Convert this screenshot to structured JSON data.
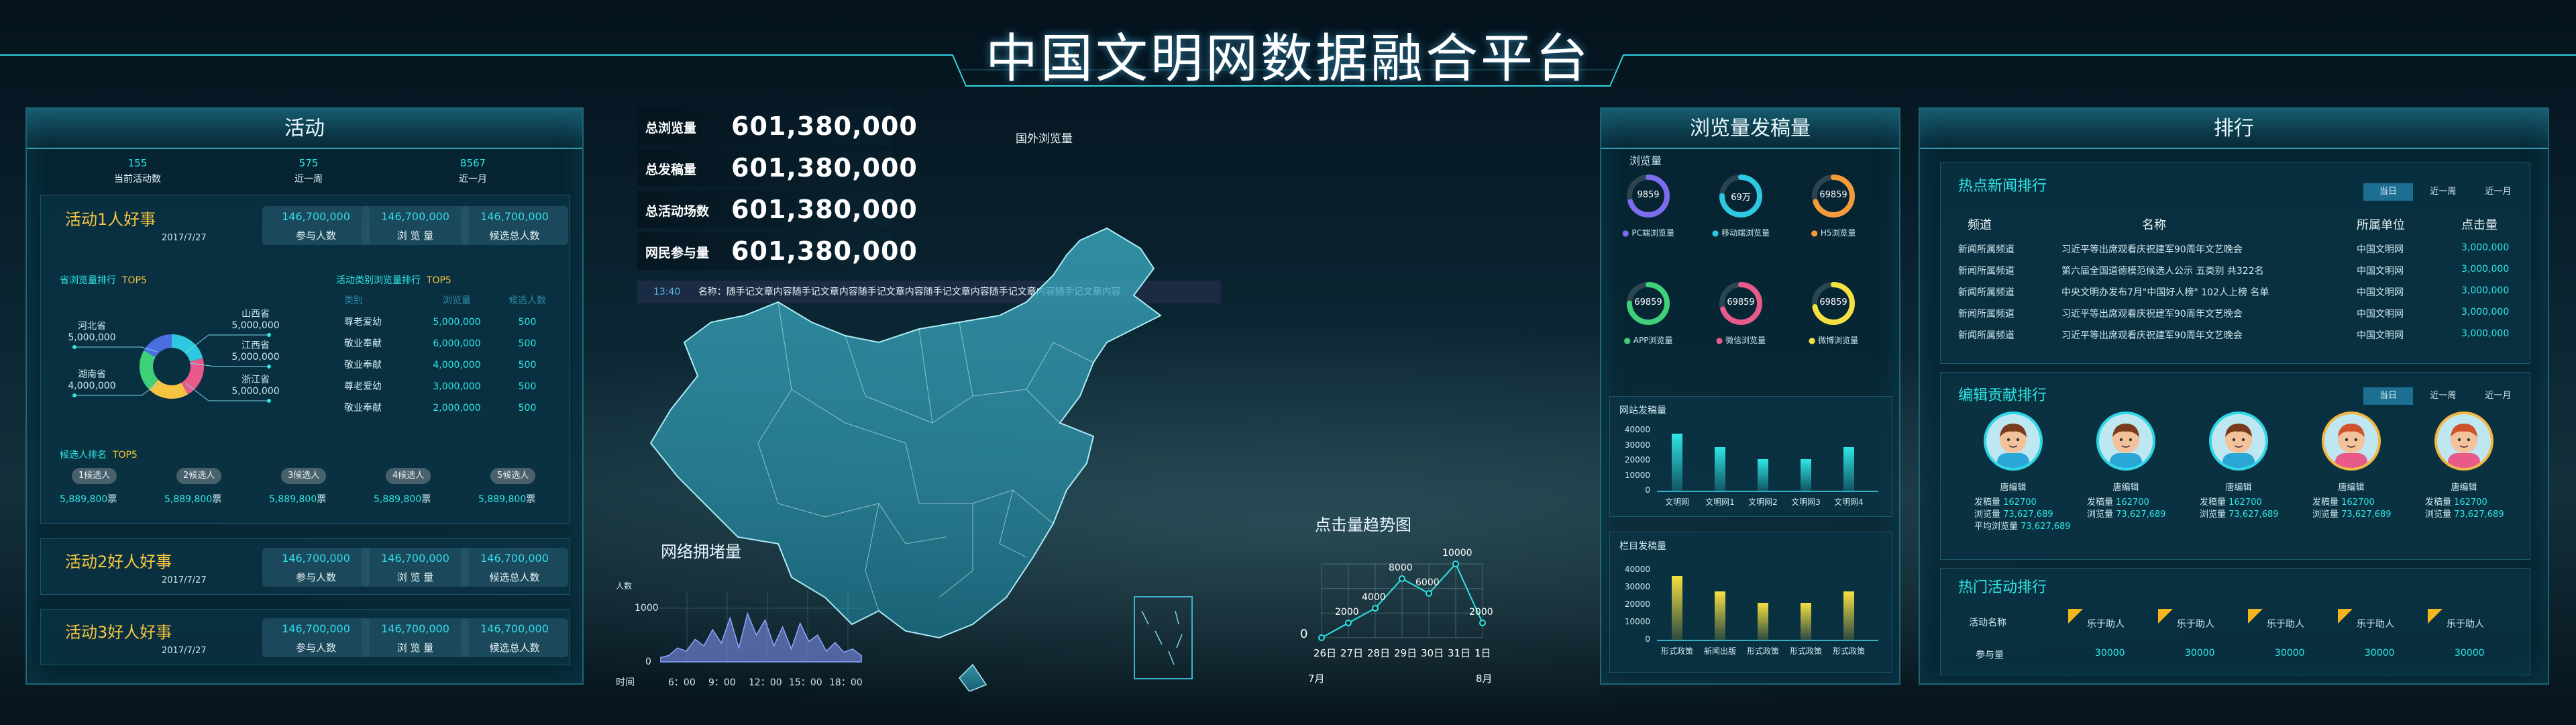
{
  "header": {
    "title": "中国文明网数据融合平台"
  },
  "activity": {
    "title": "活动",
    "summary": [
      {
        "value": "155",
        "label": "当前活动数"
      },
      {
        "value": "575",
        "label": "近一周"
      },
      {
        "value": "8567",
        "label": "近一月"
      }
    ],
    "events": [
      {
        "title": "活动1人好事",
        "date": "2017/7/27",
        "stats": [
          {
            "v": "146,700,000",
            "l": "参与人数"
          },
          {
            "v": "146,700,000",
            "l": "浏 览 量"
          },
          {
            "v": "146,700,000",
            "l": "候选总人数"
          }
        ]
      },
      {
        "title": "活动2好人好事",
        "date": "2017/7/27",
        "stats": [
          {
            "v": "146,700,000",
            "l": "参与人数"
          },
          {
            "v": "146,700,000",
            "l": "浏 览 量"
          },
          {
            "v": "146,700,000",
            "l": "候选总人数"
          }
        ]
      },
      {
        "title": "活动3好人好事",
        "date": "2017/7/27",
        "stats": [
          {
            "v": "146,700,000",
            "l": "参与人数"
          },
          {
            "v": "146,700,000",
            "l": "浏 览 量"
          },
          {
            "v": "146,700,000",
            "l": "候选总人数"
          }
        ]
      }
    ],
    "province_title": "省浏览量排行",
    "province_top": "TOP5",
    "provinces": [
      {
        "name": "山西省",
        "value": "5,000,000",
        "color": "#2ec8e0"
      },
      {
        "name": "江西省",
        "value": "5,000,000",
        "color": "#e85a8a"
      },
      {
        "name": "浙江省",
        "value": "5,000,000",
        "color": "#f5c542"
      },
      {
        "name": "河北省",
        "value": "5,000,000",
        "color": "#3fd07a"
      },
      {
        "name": "湖南省",
        "value": "4,000,000",
        "color": "#4a6ee0"
      }
    ],
    "category_title": "活动类别浏览量排行",
    "category_top": "TOP5",
    "category_headers": [
      "类别",
      "浏览量",
      "候选人数"
    ],
    "categories": [
      {
        "name": "尊老爱幼",
        "views": "5,000,000",
        "count": "500"
      },
      {
        "name": "敬业奉献",
        "views": "6,000,000",
        "count": "500"
      },
      {
        "name": "敬业奉献",
        "views": "4,000,000",
        "count": "500"
      },
      {
        "name": "尊老爱幼",
        "views": "3,000,000",
        "count": "500"
      },
      {
        "name": "敬业奉献",
        "views": "2,000,000",
        "count": "500"
      }
    ],
    "candidate_title": "候选人排名",
    "candidate_top": "TOP5",
    "candidates": [
      {
        "name": "1候选人",
        "votes": "5,889,800",
        "unit": "票"
      },
      {
        "name": "2候选人",
        "votes": "5,889,800",
        "unit": "票"
      },
      {
        "name": "3候选人",
        "votes": "5,889,800",
        "unit": "票"
      },
      {
        "name": "4候选人",
        "votes": "5,889,800",
        "unit": "票"
      },
      {
        "name": "5候选人",
        "votes": "5,889,800",
        "unit": "票"
      }
    ]
  },
  "center": {
    "kpis": [
      {
        "label": "总浏览量",
        "value": "601,380,000"
      },
      {
        "label": "总发稿量",
        "value": "601,380,000"
      },
      {
        "label": "总活动场数",
        "value": "601,380,000"
      },
      {
        "label": "网民参与量",
        "value": "601,380,000"
      }
    ],
    "foreign_label": "国外浏览量",
    "ticker": {
      "time": "13:40",
      "text": "名称：随手记文章内容随手记文章内容随手记文章内容随手记文章内容随手记文章内容随手记文章内容"
    },
    "congestion": {
      "title": "网络拥堵量",
      "ylabel": "人数",
      "ytick": "1000",
      "ytick0": "0",
      "xlabel": "时间",
      "x": [
        "6：00",
        "9：00",
        "12：00",
        "15：00",
        "18：00"
      ],
      "values": [
        80,
        120,
        260,
        200,
        420,
        300,
        600,
        350,
        820,
        260,
        900,
        500,
        780,
        300,
        650,
        240,
        720,
        380,
        500,
        200,
        360,
        180,
        240,
        120
      ]
    },
    "clicks": {
      "title": "点击量趋势图",
      "month_start": "7月",
      "month_end": "8月",
      "y0": "0",
      "points": [
        {
          "x": "26日",
          "y": 0
        },
        {
          "x": "27日",
          "y": 2000
        },
        {
          "x": "28日",
          "y": 4000
        },
        {
          "x": "29日",
          "y": 8000
        },
        {
          "x": "30日",
          "y": 6000
        },
        {
          "x": "31日",
          "y": 10000
        },
        {
          "x": "1日",
          "y": 2000
        }
      ],
      "labels": [
        "",
        "2000",
        "4000",
        "8000",
        "6000",
        "10000",
        "2000"
      ]
    }
  },
  "publish": {
    "title": "浏览量发稿量",
    "views_label": "浏览量",
    "rings": [
      {
        "value": "9859",
        "label": "PC端浏览量",
        "color": "#7b6cf0",
        "pct": 0.7
      },
      {
        "value": "69万",
        "label": "移动端浏览量",
        "color": "#2ec8e0",
        "pct": 0.75
      },
      {
        "value": "69859",
        "label": "H5浏览量",
        "color": "#f59a3a",
        "pct": 0.7
      },
      {
        "value": "69859",
        "label": "APP浏览量",
        "color": "#3fd07a",
        "pct": 0.75
      },
      {
        "value": "69859",
        "label": "微信浏览量",
        "color": "#e85a8a",
        "pct": 0.7
      },
      {
        "value": "69859",
        "label": "微博浏览量",
        "color": "#f5e042",
        "pct": 0.72
      }
    ],
    "site_chart": {
      "title": "网站发稿量",
      "yticks": [
        "40000",
        "30000",
        "20000",
        "10000",
        "0"
      ],
      "categories": [
        "文明网",
        "文明网1",
        "文明网2",
        "文明网3",
        "文明网4"
      ],
      "values": [
        38000,
        29000,
        21000,
        21000,
        29000
      ],
      "ymax": 40000
    },
    "column_chart": {
      "title": "栏目发稿量",
      "yticks": [
        "40000",
        "30000",
        "20000",
        "10000",
        "0"
      ],
      "categories": [
        "形式政策",
        "新闻出版",
        "形式政策",
        "形式政策",
        "形式政策"
      ],
      "values": [
        41000,
        31000,
        24000,
        24000,
        31000
      ],
      "ymax": 45000
    }
  },
  "ranking": {
    "title": "排行",
    "news": {
      "title": "热点新闻排行",
      "tabs": [
        "当日",
        "近一周",
        "近一月"
      ],
      "headers": [
        "频道",
        "名称",
        "所属单位",
        "点击量"
      ],
      "rows": [
        {
          "ch": "新闻所属频道",
          "name": "习近平等出席观看庆祝建军90周年文艺晚会",
          "unit": "中国文明网",
          "clicks": "3,000,000"
        },
        {
          "ch": "新闻所属频道",
          "name": "第六届全国道德模范候选人公示 五类别 共322名",
          "unit": "中国文明网",
          "clicks": "3,000,000"
        },
        {
          "ch": "新闻所属频道",
          "name": "中央文明办发布7月\"中国好人榜\" 102人上榜 名单",
          "unit": "中国文明网",
          "clicks": "3,000,000"
        },
        {
          "ch": "新闻所属频道",
          "name": "习近平等出席观看庆祝建军90周年文艺晚会",
          "unit": "中国文明网",
          "clicks": "3,000,000"
        },
        {
          "ch": "新闻所属频道",
          "name": "习近平等出席观看庆祝建军90周年文艺晚会",
          "unit": "中国文明网",
          "clicks": "3,000,000"
        }
      ]
    },
    "editors": {
      "title": "编辑贡献排行",
      "tabs": [
        "当日",
        "近一周",
        "近一月"
      ],
      "list": [
        {
          "name": "唐编辑",
          "posts_label": "发稿量",
          "posts": "162700",
          "views_label": "浏览量",
          "views": "73,627,689",
          "avg_label": "平均浏览量",
          "avg": "73,627,689",
          "skin": "#f3c29b",
          "hair": "#7a3b1c",
          "shirt": "#2aa7d6",
          "ring": "#2fd7e6"
        },
        {
          "name": "唐编辑",
          "posts_label": "发稿量",
          "posts": "162700",
          "views_label": "浏览量",
          "views": "73,627,689",
          "skin": "#f3c29b",
          "hair": "#7a3b1c",
          "shirt": "#2aa7d6",
          "ring": "#2fd7e6"
        },
        {
          "name": "唐编辑",
          "posts_label": "发稿量",
          "posts": "162700",
          "views_label": "浏览量",
          "views": "73,627,689",
          "skin": "#f3c29b",
          "hair": "#7a3b1c",
          "shirt": "#2aa7d6",
          "ring": "#2fd7e6"
        },
        {
          "name": "唐编辑",
          "posts_label": "发稿量",
          "posts": "162700",
          "views_label": "浏览量",
          "views": "73,627,689",
          "skin": "#f3c29b",
          "hair": "#d0522a",
          "shirt": "#e85a8a",
          "ring": "#f2b642"
        },
        {
          "name": "唐编辑",
          "posts_label": "发稿量",
          "posts": "162700",
          "views_label": "浏览量",
          "views": "73,627,689",
          "skin": "#f3c29b",
          "hair": "#d0522a",
          "shirt": "#e85a8a",
          "ring": "#f2b642"
        }
      ]
    },
    "hot": {
      "title": "热门活动排行",
      "name_label": "活动名称",
      "count_label": "参与量",
      "items": [
        {
          "name": "乐于助人",
          "count": "30000"
        },
        {
          "name": "乐于助人",
          "count": "30000"
        },
        {
          "name": "乐于助人",
          "count": "30000"
        },
        {
          "name": "乐于助人",
          "count": "30000"
        },
        {
          "name": "乐于助人",
          "count": "30000"
        }
      ]
    }
  }
}
